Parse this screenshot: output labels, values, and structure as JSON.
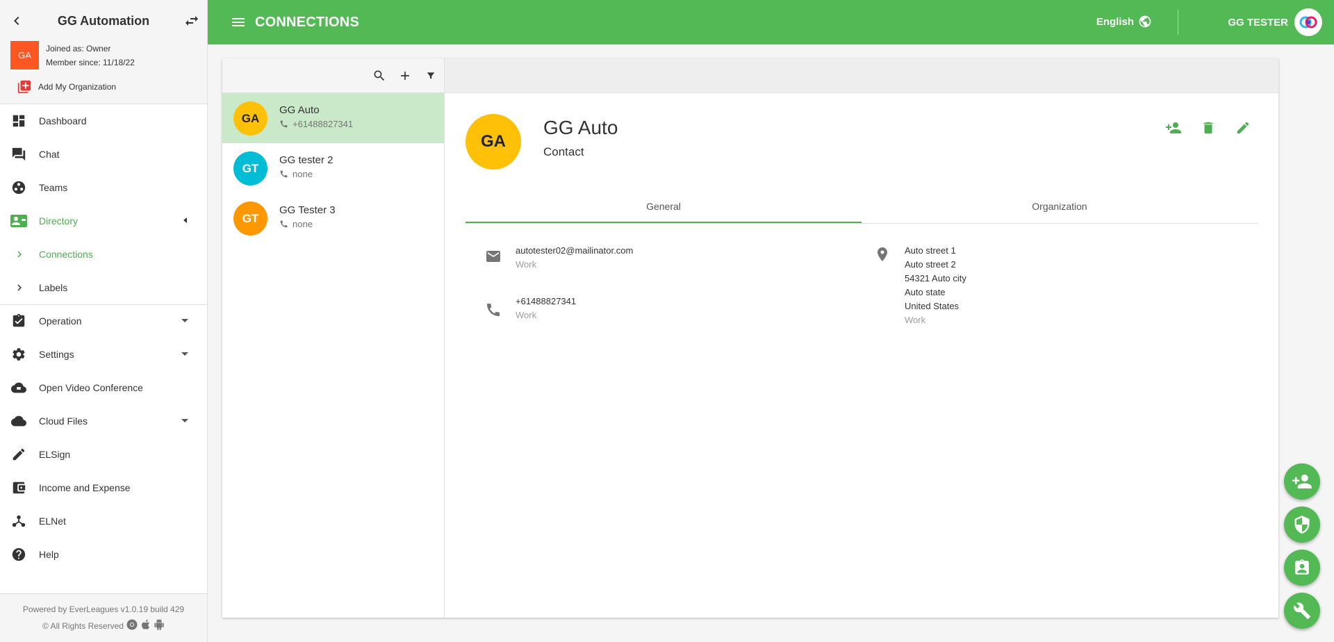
{
  "sidebar": {
    "title": "GG Automation",
    "org_avatar": "GA",
    "joined": "Joined as: Owner",
    "member_since": "Member since: 11/18/22",
    "add_org": "Add My Organization",
    "items": [
      {
        "label": "Dashboard",
        "icon": "dashboard-icon"
      },
      {
        "label": "Chat",
        "icon": "chat-icon"
      },
      {
        "label": "Teams",
        "icon": "teams-icon"
      },
      {
        "label": "Directory",
        "icon": "directory-icon"
      },
      {
        "label": "Connections",
        "icon": "chevron-right-icon"
      },
      {
        "label": "Labels",
        "icon": "chevron-right-icon"
      },
      {
        "label": "Operation",
        "icon": "clipboard-check-icon"
      },
      {
        "label": "Settings",
        "icon": "gear-icon"
      },
      {
        "label": "Open Video Conference",
        "icon": "cloud-icon"
      },
      {
        "label": "Cloud Files",
        "icon": "cloud-icon"
      },
      {
        "label": "ELSign",
        "icon": "pen-icon"
      },
      {
        "label": "Income and Expense",
        "icon": "wallet-icon"
      },
      {
        "label": "ELNet",
        "icon": "network-icon"
      },
      {
        "label": "Help",
        "icon": "help-icon"
      }
    ],
    "footer_powered": "Powered by EverLeagues v1.0.19 build 429",
    "footer_rights": "© All Rights Reserved"
  },
  "topbar": {
    "title": "CONNECTIONS",
    "language": "English",
    "user": "GG TESTER"
  },
  "contacts": [
    {
      "initials": "GA",
      "name": "GG Auto",
      "phone": "+61488827341",
      "color": "#ffc107",
      "text_color": "#222222"
    },
    {
      "initials": "GT",
      "name": "GG tester 2",
      "phone": "none",
      "color": "#00bcd4",
      "text_color": "#ffffff"
    },
    {
      "initials": "GT",
      "name": "GG Tester 3",
      "phone": "none",
      "color": "#ff9800",
      "text_color": "#ffffff"
    }
  ],
  "detail": {
    "initials": "GA",
    "name": "GG Auto",
    "type": "Contact",
    "tabs": [
      "General",
      "Organization"
    ],
    "email": "autotester02@mailinator.com",
    "email_type": "Work",
    "phone": "+61488827341",
    "phone_type": "Work",
    "address": [
      "Auto street 1",
      "Auto street 2",
      "54321 Auto city",
      "Auto state",
      "United States"
    ],
    "address_type": "Work"
  },
  "colors": {
    "primary": "#53b954",
    "selected": "#c9e9c9",
    "org_avatar": "#ff5722"
  }
}
